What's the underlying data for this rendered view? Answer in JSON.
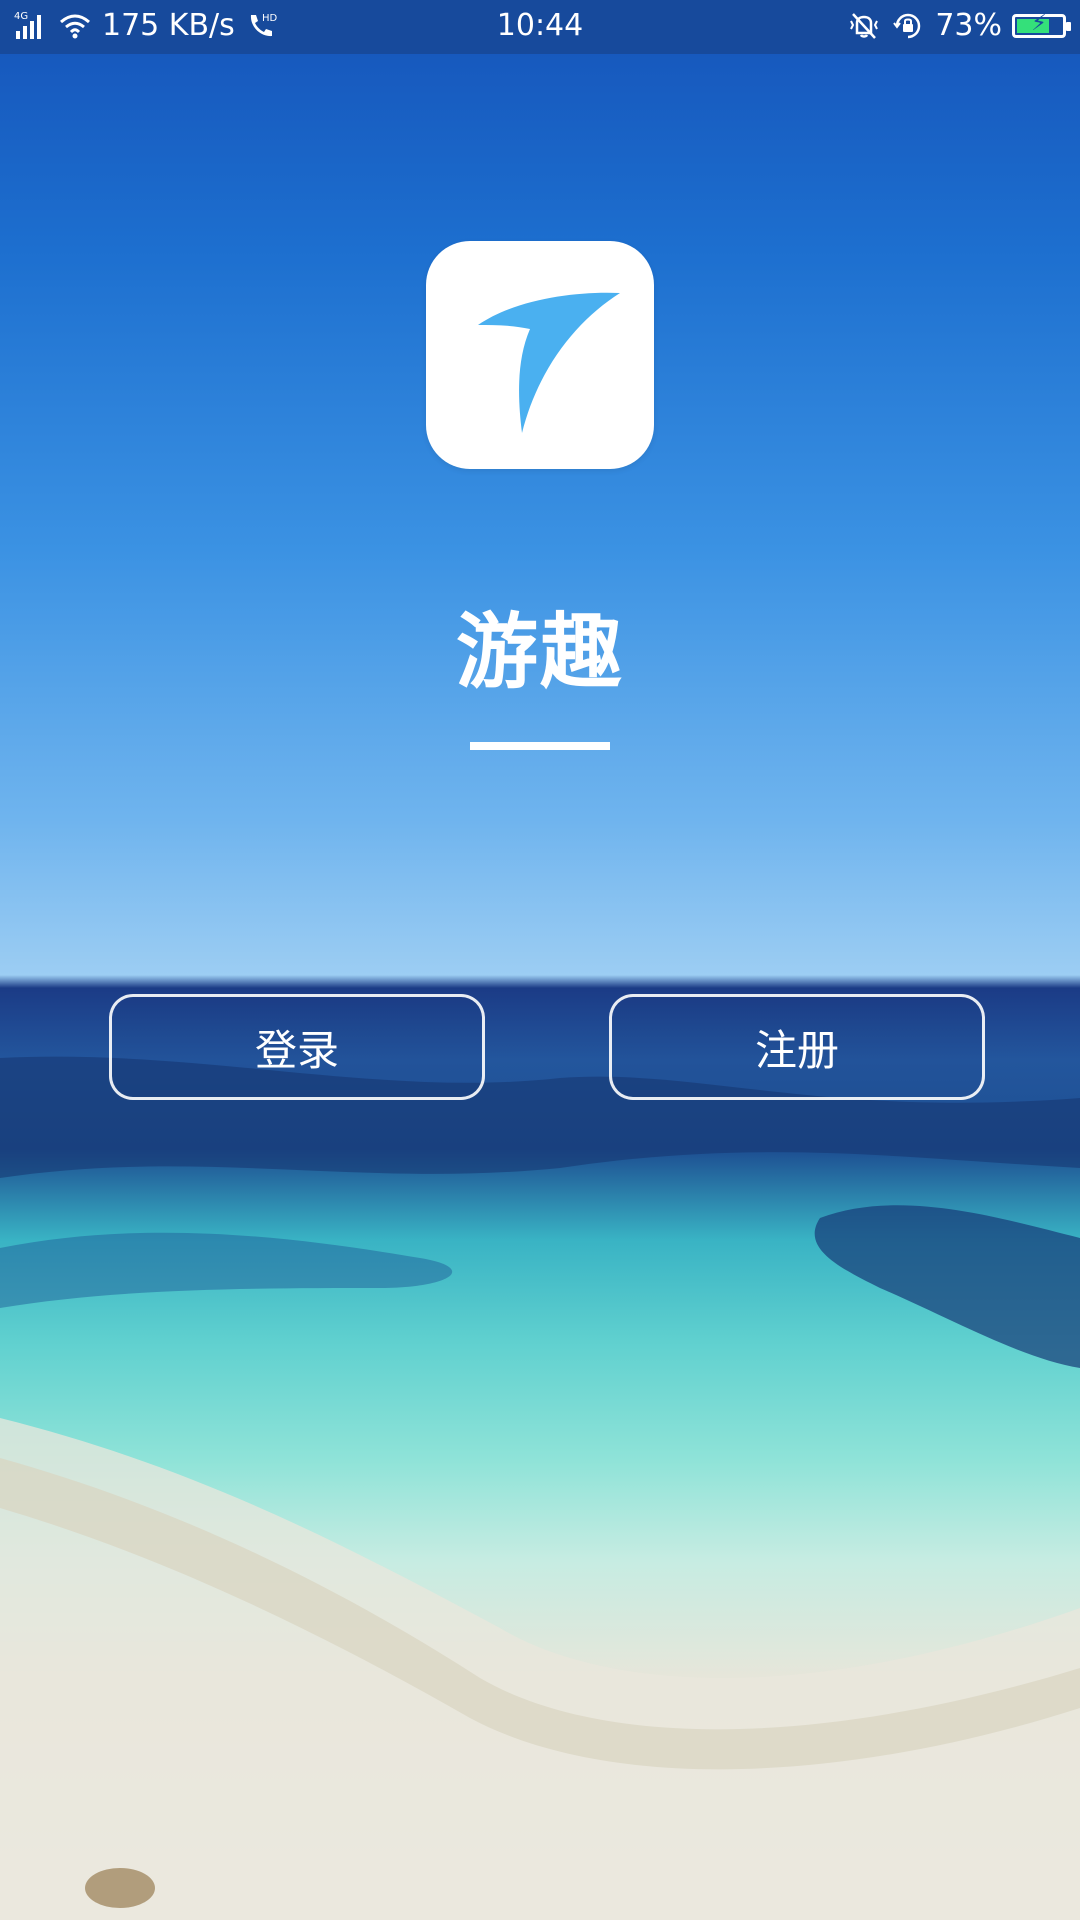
{
  "status_bar": {
    "network_type": "4G",
    "net_speed": "175 KB/s",
    "hd_label": "HD",
    "time": "10:44",
    "battery_percent_text": "73%",
    "battery_level": 0.73,
    "icons": [
      "signal-icon",
      "wifi-icon",
      "hd-call-icon",
      "vibrate-icon",
      "rotation-lock-icon",
      "battery-icon"
    ]
  },
  "app": {
    "name": "游趣",
    "logo_icon": "paper-plane-arrow-icon",
    "logo_color": "#4ab0f0"
  },
  "buttons": {
    "login_label": "登录",
    "register_label": "注册"
  },
  "colors": {
    "status_bar_bg": "#174a9c",
    "text": "#ffffff"
  }
}
